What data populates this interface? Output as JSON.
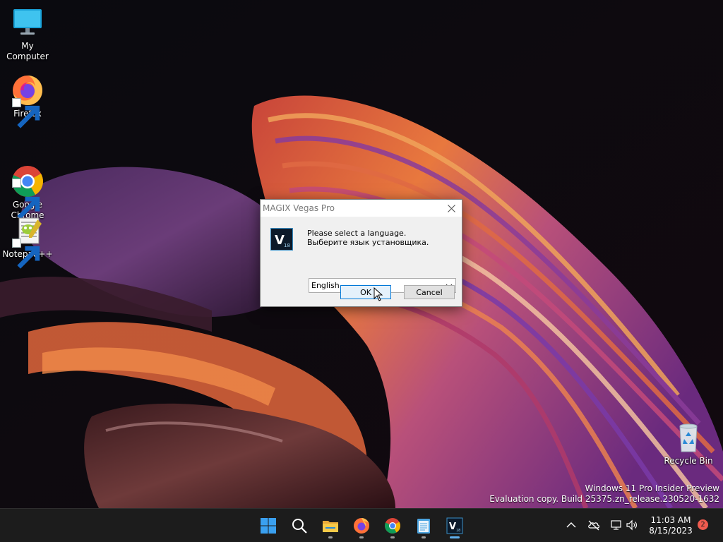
{
  "desktop": {
    "icons": [
      {
        "label": "My Computer",
        "icon": "monitor-icon"
      },
      {
        "label": "Firefox",
        "icon": "firefox-icon"
      },
      {
        "label": "Google\nChrome",
        "icon": "chrome-icon"
      },
      {
        "label": "Notepad++",
        "icon": "notepadpp-icon"
      },
      {
        "label": "Recycle Bin",
        "icon": "recycle-bin-icon"
      }
    ],
    "watermark": {
      "line1": "Windows 11 Pro Insider Preview",
      "line2": "Evaluation copy. Build 25375.zn_release.230520-1632"
    }
  },
  "dialog": {
    "title": "MAGIX Vegas Pro",
    "app_icon": "vegas-pro-icon",
    "prompt_en": "Please select a language.",
    "prompt_ru": "Выберите язык установщика.",
    "language_select": {
      "selected": "English"
    },
    "ok_label": "OK",
    "cancel_label": "Cancel"
  },
  "taskbar": {
    "apps": [
      "start-icon",
      "search-icon",
      "file-explorer-icon",
      "firefox-icon",
      "chrome-icon",
      "notepad-icon",
      "vegas-pro-icon"
    ],
    "tray": [
      "chevron-up-icon",
      "cloud-offline-icon",
      "network-icon",
      "volume-icon"
    ],
    "clock": {
      "time": "11:03 AM",
      "date": "8/15/2023"
    },
    "notification_count": "2"
  },
  "colors": {
    "taskbar_bg": "#1c1c1c",
    "dialog_bg": "#f0f0f0",
    "ok_border": "#0078d7",
    "badge": "#ef5b4f"
  }
}
